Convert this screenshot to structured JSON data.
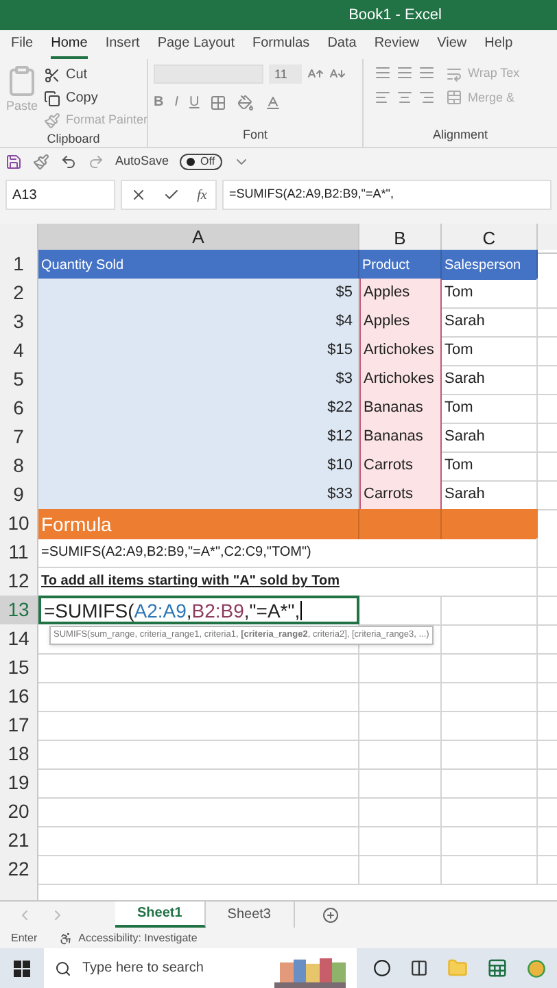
{
  "window": {
    "title": "Book1 - Excel"
  },
  "ribbon_tabs": [
    {
      "label": "File",
      "selected": false
    },
    {
      "label": "Home",
      "selected": true
    },
    {
      "label": "Insert",
      "selected": false
    },
    {
      "label": "Page Layout",
      "selected": false
    },
    {
      "label": "Formulas",
      "selected": false
    },
    {
      "label": "Data",
      "selected": false
    },
    {
      "label": "Review",
      "selected": false
    },
    {
      "label": "View",
      "selected": false
    },
    {
      "label": "Help",
      "selected": false
    }
  ],
  "clipboard": {
    "paste": "Paste",
    "cut": "Cut",
    "copy": "Copy",
    "format_painter": "Format Painter",
    "label": "Clipboard"
  },
  "font": {
    "size": "11",
    "format_buttons": [
      "B",
      "I",
      "U"
    ],
    "label": "Font"
  },
  "alignment": {
    "wrap_text": "Wrap Tex",
    "merge": "Merge &",
    "label": "Alignment"
  },
  "quick_access": {
    "autosave_label": "AutoSave",
    "autosave_toggle": {
      "label": "Off",
      "on": false
    }
  },
  "formula_bar": {
    "name_box": "A13",
    "function_label": "fx",
    "formula": "=SUMIFS(A2:A9,B2:B9,\"=A*\","
  },
  "columns": [
    {
      "label": "A",
      "selected": true
    },
    {
      "label": "B",
      "selected": false
    },
    {
      "label": "C",
      "selected": false
    }
  ],
  "rows": [
    {
      "label": "1",
      "kind": "header",
      "selected": false,
      "cells": [
        "Quantity Sold",
        "Product",
        "Salesperson"
      ]
    },
    {
      "label": "2",
      "kind": "data",
      "selected": false,
      "cells": [
        "$5",
        "Apples",
        "Tom"
      ]
    },
    {
      "label": "3",
      "kind": "data",
      "selected": false,
      "cells": [
        "$4",
        "Apples",
        "Sarah"
      ]
    },
    {
      "label": "4",
      "kind": "data",
      "selected": false,
      "cells": [
        "$15",
        "Artichokes",
        "Tom"
      ]
    },
    {
      "label": "5",
      "kind": "data",
      "selected": false,
      "cells": [
        "$3",
        "Artichokes",
        "Sarah"
      ]
    },
    {
      "label": "6",
      "kind": "data",
      "selected": false,
      "cells": [
        "$22",
        "Bananas",
        "Tom"
      ]
    },
    {
      "label": "7",
      "kind": "data",
      "selected": false,
      "cells": [
        "$12",
        "Bananas",
        "Sarah"
      ]
    },
    {
      "label": "8",
      "kind": "data",
      "selected": false,
      "cells": [
        "$10",
        "Carrots",
        "Tom"
      ]
    },
    {
      "label": "9",
      "kind": "data",
      "selected": false,
      "cells": [
        "$33",
        "Carrots",
        "Sarah"
      ]
    },
    {
      "label": "10",
      "kind": "section",
      "selected": false,
      "cells": [
        "Formula"
      ]
    },
    {
      "label": "11",
      "kind": "text",
      "selected": false,
      "cells": [
        "=SUMIFS(A2:A9,B2:B9,\"=A*\",C2:C9,\"TOM\")"
      ]
    },
    {
      "label": "12",
      "kind": "note",
      "selected": false,
      "cells": [
        "To add all items starting with \"A\" sold by Tom"
      ]
    },
    {
      "label": "13",
      "kind": "editing",
      "selected": true,
      "parts": [
        {
          "before": "=SUMIFS(",
          "ref": "A2:A9",
          "color": "#2e75b6"
        },
        {
          "before": ",",
          "ref": "B2:B9",
          "color": "#8e3b5e"
        }
      ],
      "tail": ",\"=A*\","
    },
    {
      "label": "14",
      "kind": "empty",
      "selected": false
    },
    {
      "label": "15",
      "kind": "empty",
      "selected": false
    },
    {
      "label": "16",
      "kind": "empty",
      "selected": false
    },
    {
      "label": "17",
      "kind": "empty",
      "selected": false
    },
    {
      "label": "18",
      "kind": "empty",
      "selected": false
    },
    {
      "label": "19",
      "kind": "empty",
      "selected": false
    },
    {
      "label": "20",
      "kind": "empty",
      "selected": false
    },
    {
      "label": "21",
      "kind": "empty",
      "selected": false
    },
    {
      "label": "22",
      "kind": "empty",
      "selected": false
    }
  ],
  "function_tooltip": "SUMIFS(sum_range, criteria_range1, criteria1, **[criteria_range2**, criteria2], [criteria_range3, ...)",
  "sheet_tabs": [
    {
      "label": "Sheet1",
      "selected": true
    },
    {
      "label": "Sheet3",
      "selected": false
    }
  ],
  "status_bar": {
    "mode": "Enter",
    "accessibility": "Accessibility: Investigate"
  },
  "taskbar": {
    "search": {
      "placeholder": "Type here to search"
    }
  }
}
